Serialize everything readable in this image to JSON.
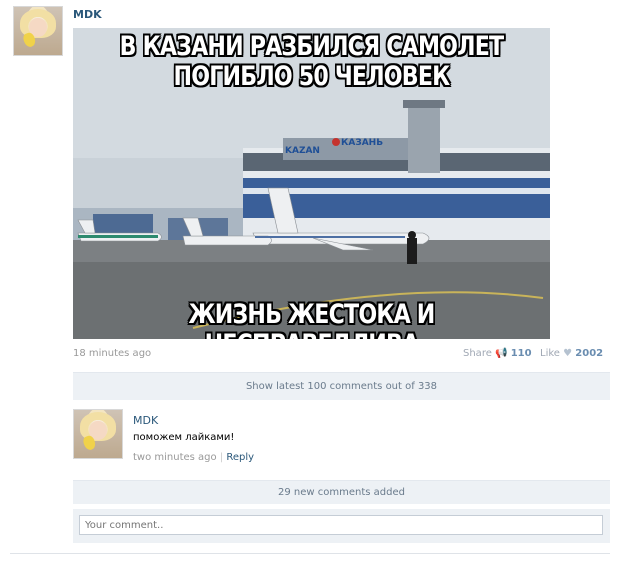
{
  "post": {
    "author": "MDK",
    "time": "18 minutes ago",
    "share_label": "Share",
    "share_count": "110",
    "like_label": "Like",
    "like_count": "2002"
  },
  "image": {
    "top_line1": "В КАЗАНИ РАЗБИЛСЯ САМОЛЕТ",
    "top_line2": "ПОГИБЛО 50 ЧЕЛОВЕК",
    "bottom_line": "ЖИЗНЬ ЖЕСТОКА И НЕСПРАВЕДЛИВА",
    "sign_left": "KAZAN",
    "sign_right": "КАЗАНЬ"
  },
  "comments_bar": "Show latest 100 comments out of 338",
  "comment": {
    "author": "MDK",
    "text": "поможем лайками!",
    "time": "two minutes ago",
    "separator": "|",
    "reply_label": "Reply"
  },
  "new_comments": "29 new comments added",
  "comment_input": {
    "placeholder": "Your comment.."
  }
}
